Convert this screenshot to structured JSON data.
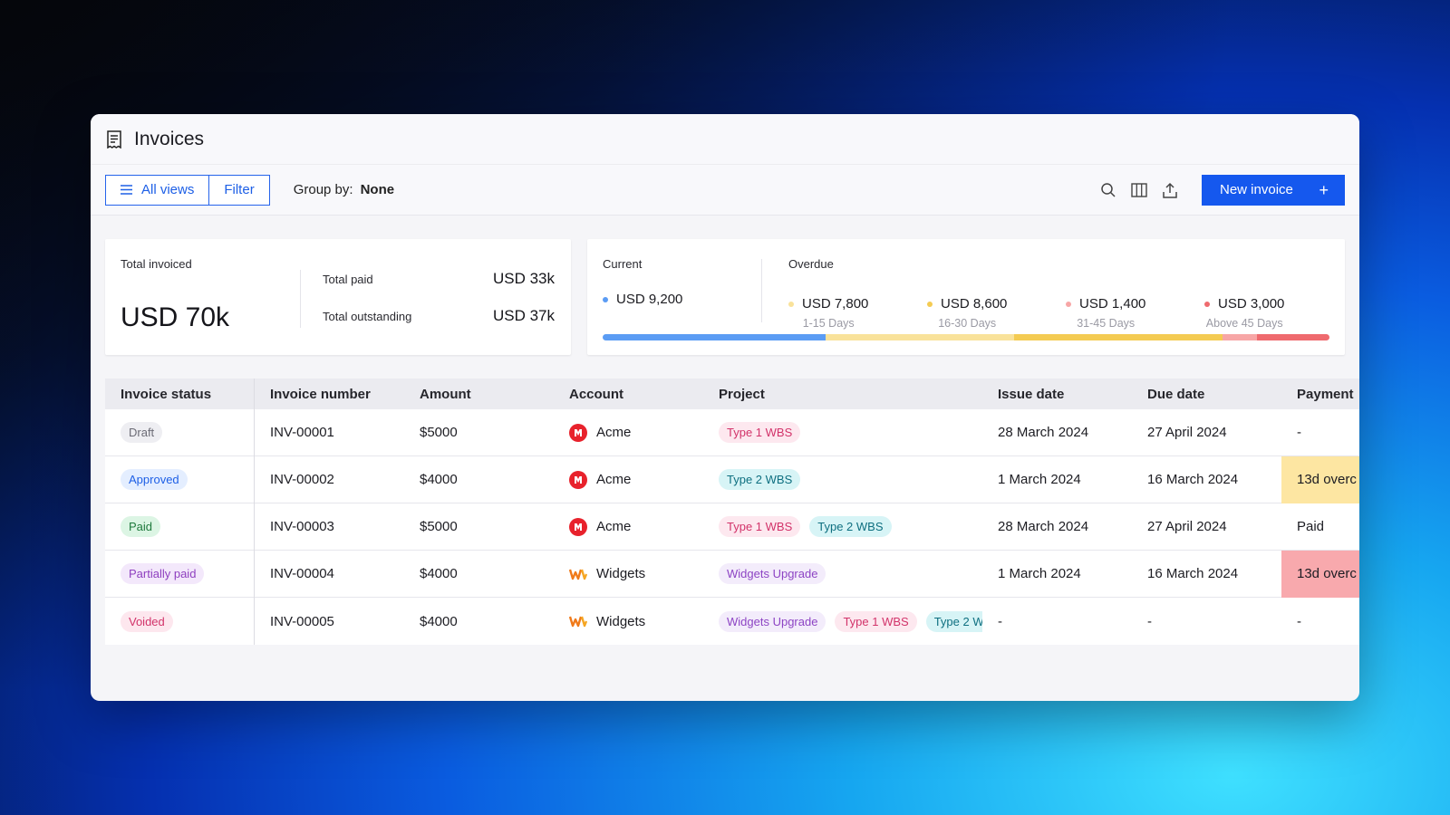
{
  "window": {
    "title": "Invoices",
    "title_icon": "receipt-icon"
  },
  "toolbar": {
    "all_views_label": "All views",
    "filter_label": "Filter",
    "group_by_label": "Group by:",
    "group_by_value": "None",
    "new_invoice_label": "New invoice",
    "icons": [
      "search-icon",
      "columns-icon",
      "export-icon",
      "plus-icon"
    ]
  },
  "summary": {
    "total_invoiced_label": "Total invoiced",
    "total_invoiced_value": "USD 70k",
    "total_paid_label": "Total paid",
    "total_paid_value": "USD 33k",
    "total_outstanding_label": "Total outstanding",
    "total_outstanding_value": "USD 37k",
    "current_label": "Current",
    "current_value": "USD 9,200",
    "overdue_label": "Overdue",
    "overdue": [
      {
        "value": "USD 7,800",
        "range": "1-15 Days",
        "color": "#f9e29a",
        "amount": 7800
      },
      {
        "value": "USD 8,600",
        "range": "16-30 Days",
        "color": "#f4cb52",
        "amount": 8600
      },
      {
        "value": "USD 1,400",
        "range": "31-45 Days",
        "color": "#f7a6a6",
        "amount": 1400
      },
      {
        "value": "USD 3,000",
        "range": "Above 45 Days",
        "color": "#ef6a6e",
        "amount": 3000
      }
    ],
    "current_color": "#5b9cf4",
    "current_amount": 9200
  },
  "table": {
    "headers": [
      "Invoice status",
      "Invoice number",
      "Amount",
      "Account",
      "Project",
      "Issue date",
      "Due date",
      "Payment"
    ],
    "rows": [
      {
        "status": "Draft",
        "number": "INV-00001",
        "amount": "$5000",
        "account": "Acme",
        "projects": [
          "Type 1 WBS"
        ],
        "issue": "28 March 2024",
        "due": "27 April 2024",
        "payment": "-"
      },
      {
        "status": "Approved",
        "number": "INV-00002",
        "amount": "$4000",
        "account": "Acme",
        "projects": [
          "Type 2 WBS"
        ],
        "issue": "1 March 2024",
        "due": "16 March 2024",
        "payment": "13d overc"
      },
      {
        "status": "Paid",
        "number": "INV-00003",
        "amount": "$5000",
        "account": "Acme",
        "projects": [
          "Type 1 WBS",
          "Type 2 WBS"
        ],
        "issue": "28 March 2024",
        "due": "27 April 2024",
        "payment": "Paid"
      },
      {
        "status": "Partially paid",
        "number": "INV-00004",
        "amount": "$4000",
        "account": "Widgets",
        "projects": [
          "Widgets Upgrade"
        ],
        "issue": "1 March 2024",
        "due": "16 March 2024",
        "payment": "13d overc"
      },
      {
        "status": "Voided",
        "number": "INV-00005",
        "amount": "$4000",
        "account": "Widgets",
        "projects": [
          "Widgets Upgrade",
          "Type 1 WBS",
          "Type 2 W"
        ],
        "issue": "-",
        "due": "-",
        "payment": "-"
      }
    ]
  },
  "colors": {
    "primary": "#1558ee",
    "status_draft_bg": "#eeeef2",
    "status_draft_fg": "#6b6b75",
    "status_approved_bg": "#e4eeff",
    "status_approved_fg": "#1d5fe6",
    "status_paid_bg": "#dcf5e4",
    "status_paid_fg": "#1f7a3d",
    "status_partial_bg": "#f3e8fb",
    "status_partial_fg": "#8e3fbf",
    "status_voided_bg": "#fde7ee",
    "status_voided_fg": "#d2336a",
    "tag_type1_bg": "#fde8ef",
    "tag_type1_fg": "#d2336a",
    "tag_type2_bg": "#d7f4f6",
    "tag_type2_fg": "#0e6f80",
    "tag_widgets_bg": "#f3ecfb",
    "tag_widgets_fg": "#8d44c4",
    "payment_warn_bg": "#fde6a2",
    "payment_overdue_bg": "#f8a9ad"
  }
}
